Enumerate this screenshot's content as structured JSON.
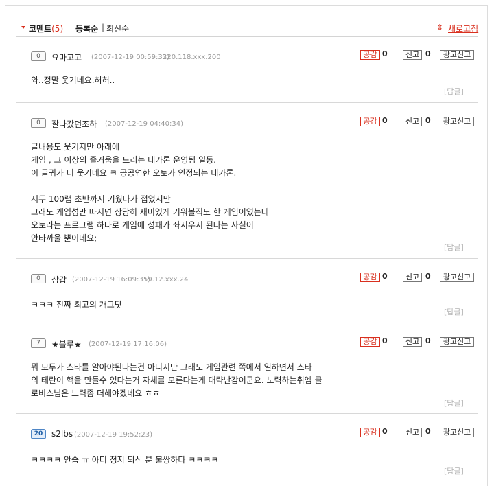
{
  "header": {
    "title": "코멘트",
    "count": "(5)",
    "sort_registered": "등록순",
    "sort_separator": "|",
    "sort_latest": "최신순",
    "refresh_icon": "⇕",
    "refresh_label": "새로고침",
    "accent_color": "#d9301f"
  },
  "comments": [
    {
      "level": "0",
      "nick": "요마고고",
      "date": "(2007-12-19 00:59:33)",
      "ip": "220.118.xxx.200",
      "like_label": "공감",
      "like_count": "0",
      "report_label": "신고",
      "report_count": "0",
      "ad_label": "광고신고",
      "text": "와..정말 웃기네요.허허..",
      "reply_label": "[답글]"
    },
    {
      "level": "0",
      "nick": "잘나갔던조하",
      "date": "(2007-12-19 04:40:34)",
      "ip": "",
      "like_label": "공감",
      "like_count": "0",
      "report_label": "신고",
      "report_count": "0",
      "ad_label": "광고신고",
      "text": "글내용도 웃기지만 아래에\n게임 , 그 이상의 즐거움을 드리는 데카론 운영팀 일동.\n이 글귀가 더 웃기네요 ㅋ 공공연한 오토가 인정되는 데카론.\n\n저두 100랩 초반까지 키웠다가 접었지만\n그래도 게임성만 따지면 상당히 재미있게 키워볼직도 한 게임이였는데\n오토라는 프로그램 하나로 게임에 성패가 좌지우지 된다는 사실이\n안타까울 뿐이네요;",
      "reply_label": "[답글]"
    },
    {
      "level": "0",
      "nick": "삼갑",
      "date": "(2007-12-19 16:09:31)",
      "ip": "59.12.xxx.24",
      "like_label": "공감",
      "like_count": "0",
      "report_label": "신고",
      "report_count": "0",
      "ad_label": "광고신고",
      "text": "ㅋㅋㅋ 진짜 최고의 개그닷",
      "reply_label": "[답글]"
    },
    {
      "level": "7",
      "nick": "★블루★",
      "date": "(2007-12-19 17:16:06)",
      "ip": "",
      "like_label": "공감",
      "like_count": "0",
      "report_label": "신고",
      "report_count": "0",
      "ad_label": "광고신고",
      "text": "뭐 모두가 스타를 알아야된다는건 아니지만 그래도 게임관련 쪽에서 일하면서 스타\n의 테란이 핵을 만들수 있다는거 자체를 모른다는게 대략난감이군요. 노력하는취엠 클\n로비스님은 노력좀 더해야겠네요 ㅎㅎ",
      "reply_label": "[답글]"
    },
    {
      "level": "20",
      "nick": "s2lbs",
      "date": "(2007-12-19 19:52:23)",
      "ip": "",
      "like_label": "공감",
      "like_count": "0",
      "report_label": "신고",
      "report_count": "0",
      "ad_label": "광고신고",
      "text": "ㅋㅋㅋㅋ 안습 ㅠ 아디 정지 되신 분 불쌍하다 ㅋㅋㅋㅋ",
      "reply_label": "[답글]"
    }
  ]
}
